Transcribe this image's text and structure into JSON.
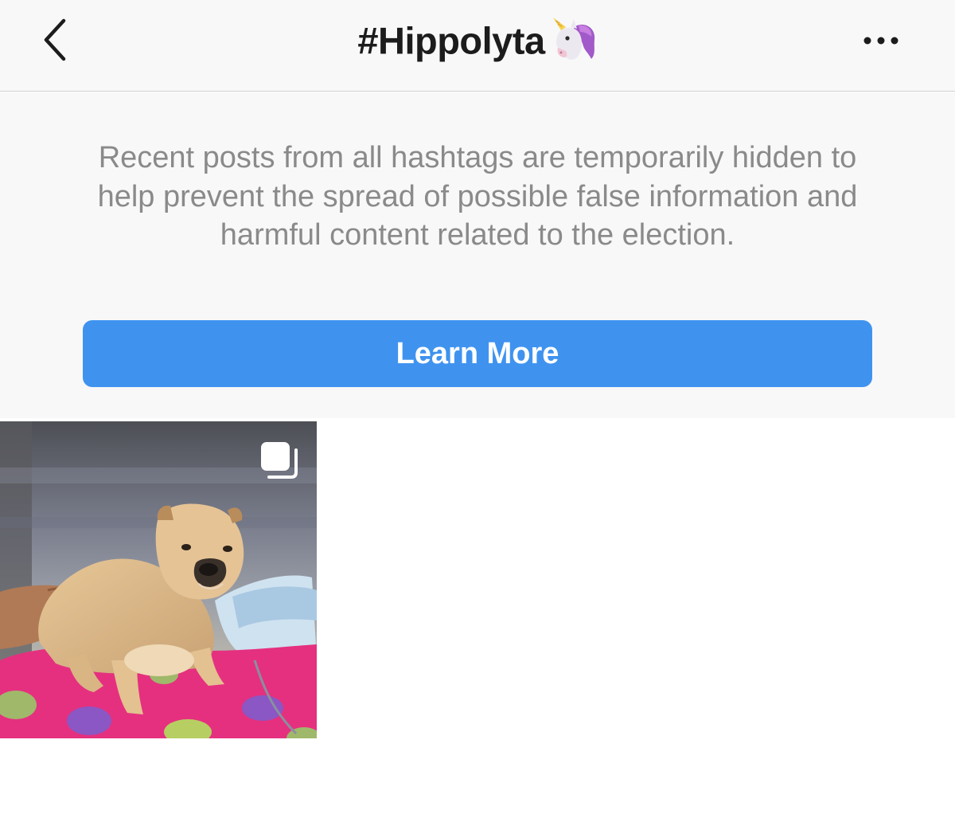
{
  "header": {
    "title": "#Hippolyta",
    "title_emoji": "unicorn-emoji",
    "back_icon": "chevron-left-icon",
    "more_icon": "ellipsis-icon"
  },
  "notice": {
    "message": "Recent posts from all hashtags are temporarily hidden to help prevent the spread of possible false information and harmful content related to the election.",
    "button_label": "Learn More",
    "button_color": "#3f93ef"
  },
  "grid": {
    "posts": [
      {
        "type": "carousel",
        "icon": "multiple-photos-icon"
      }
    ]
  }
}
